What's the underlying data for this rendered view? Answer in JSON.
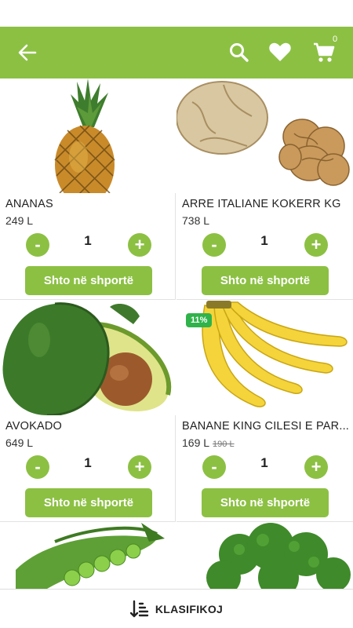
{
  "colors": {
    "primary": "#8cc043",
    "discount_badge": "#2fb34a",
    "divider": "#e2e2e2"
  },
  "header": {
    "back_icon": "arrow-left-icon",
    "search_icon": "search-icon",
    "favorites_icon": "heart-icon",
    "cart_icon": "shopping-cart-icon",
    "cart_count": "0"
  },
  "products": [
    {
      "name": "ANANAS",
      "price": "249 L",
      "quantity": "1",
      "minus": "-",
      "plus": "+",
      "add_label": "Shto në shportë"
    },
    {
      "name": "ARRE ITALIANE KOKERR KG",
      "price": "738 L",
      "quantity": "1",
      "minus": "-",
      "plus": "+",
      "add_label": "Shto në shportë"
    },
    {
      "name": "AVOKADO",
      "price": "649 L",
      "quantity": "1",
      "minus": "-",
      "plus": "+",
      "add_label": "Shto në shportë"
    },
    {
      "name": "BANANE KING CILESI E PAR...",
      "price": "169 L",
      "old_price": "190 L",
      "discount": "11%",
      "quantity": "1",
      "minus": "-",
      "plus": "+",
      "add_label": "Shto në shportë"
    }
  ],
  "bottom_bar": {
    "sort_icon": "sort-icon",
    "label": "KLASIFIKOJ"
  }
}
